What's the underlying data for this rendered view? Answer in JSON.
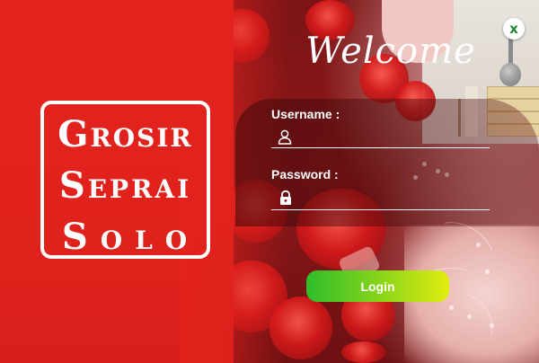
{
  "logo": {
    "line1": "Grosir",
    "line2": "Seprai",
    "line3": "Solo"
  },
  "welcome": "Welcome",
  "close_button": {
    "label": "x"
  },
  "form": {
    "username_label": "Username :",
    "password_label": "Password :",
    "username_value": "",
    "password_value": "",
    "login_label": "Login"
  },
  "icons": {
    "username": "user-icon",
    "password": "lock-icon",
    "close": "close-icon"
  },
  "colors": {
    "brand_red": "#e2221c",
    "login_gradient_start": "#2fbd2b",
    "login_gradient_end": "#e2ec10",
    "close_x": "#1e8a2e"
  }
}
